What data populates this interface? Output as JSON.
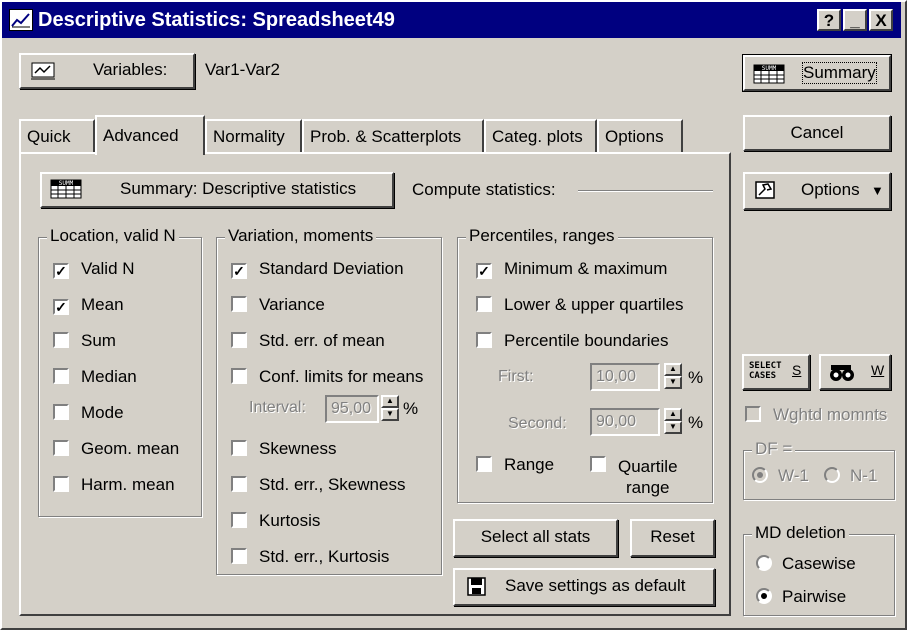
{
  "window": {
    "title": "Descriptive Statistics: Spreadsheet49",
    "controls": {
      "help": "?",
      "minimize": "_",
      "close": "X"
    }
  },
  "variables": {
    "button_label": "Variables:",
    "value": "Var1-Var2"
  },
  "right": {
    "summary_label": "Summary",
    "cancel_label": "Cancel",
    "options_label": "Options",
    "select_cases_line1": "SELECT",
    "select_cases_line2": "CASES",
    "select_cases_key": "S",
    "weight_key": "W",
    "wghtd_label": "Wghtd momnts",
    "df_label": "DF =",
    "df_options": [
      "W-1",
      "N-1"
    ],
    "md_label": "MD deletion",
    "md_options": [
      "Casewise",
      "Pairwise"
    ],
    "md_selected": "Pairwise"
  },
  "tabs": [
    "Quick",
    "Advanced",
    "Normality",
    "Prob. & Scatterplots",
    "Categ. plots",
    "Options"
  ],
  "active_tab": "Advanced",
  "summary_button_label": "Summary: Descriptive statistics",
  "compute_label": "Compute statistics:",
  "location": {
    "label": "Location, valid N",
    "items": [
      {
        "label": "Valid N",
        "checked": true
      },
      {
        "label": "Mean",
        "checked": true
      },
      {
        "label": "Sum",
        "checked": false
      },
      {
        "label": "Median",
        "checked": false
      },
      {
        "label": "Mode",
        "checked": false
      },
      {
        "label": "Geom. mean",
        "checked": false
      },
      {
        "label": "Harm. mean",
        "checked": false
      }
    ]
  },
  "variation": {
    "label": "Variation, moments",
    "items": [
      {
        "label": "Standard Deviation",
        "checked": true
      },
      {
        "label": "Variance",
        "checked": false
      },
      {
        "label": "Std. err. of mean",
        "checked": false
      },
      {
        "label": "Conf. limits for means",
        "checked": false
      },
      {
        "label": "Skewness",
        "checked": false
      },
      {
        "label": "Std. err., Skewness",
        "checked": false
      },
      {
        "label": "Kurtosis",
        "checked": false
      },
      {
        "label": "Std. err., Kurtosis",
        "checked": false
      }
    ],
    "interval_label": "Interval:",
    "interval_value": "95,00",
    "percent": "%"
  },
  "percentiles": {
    "label": "Percentiles, ranges",
    "items": [
      {
        "label": "Minimum & maximum",
        "checked": true
      },
      {
        "label": "Lower & upper quartiles",
        "checked": false
      },
      {
        "label": "Percentile boundaries",
        "checked": false
      }
    ],
    "first_label": "First:",
    "first_value": "10,00",
    "second_label": "Second:",
    "second_value": "90,00",
    "percent": "%",
    "range_label": "Range",
    "quartile_range_line1": "Quartile",
    "quartile_range_line2": "range"
  },
  "bottom_buttons": {
    "select_all": "Select all stats",
    "reset": "Reset",
    "save_default": "Save settings as default"
  }
}
